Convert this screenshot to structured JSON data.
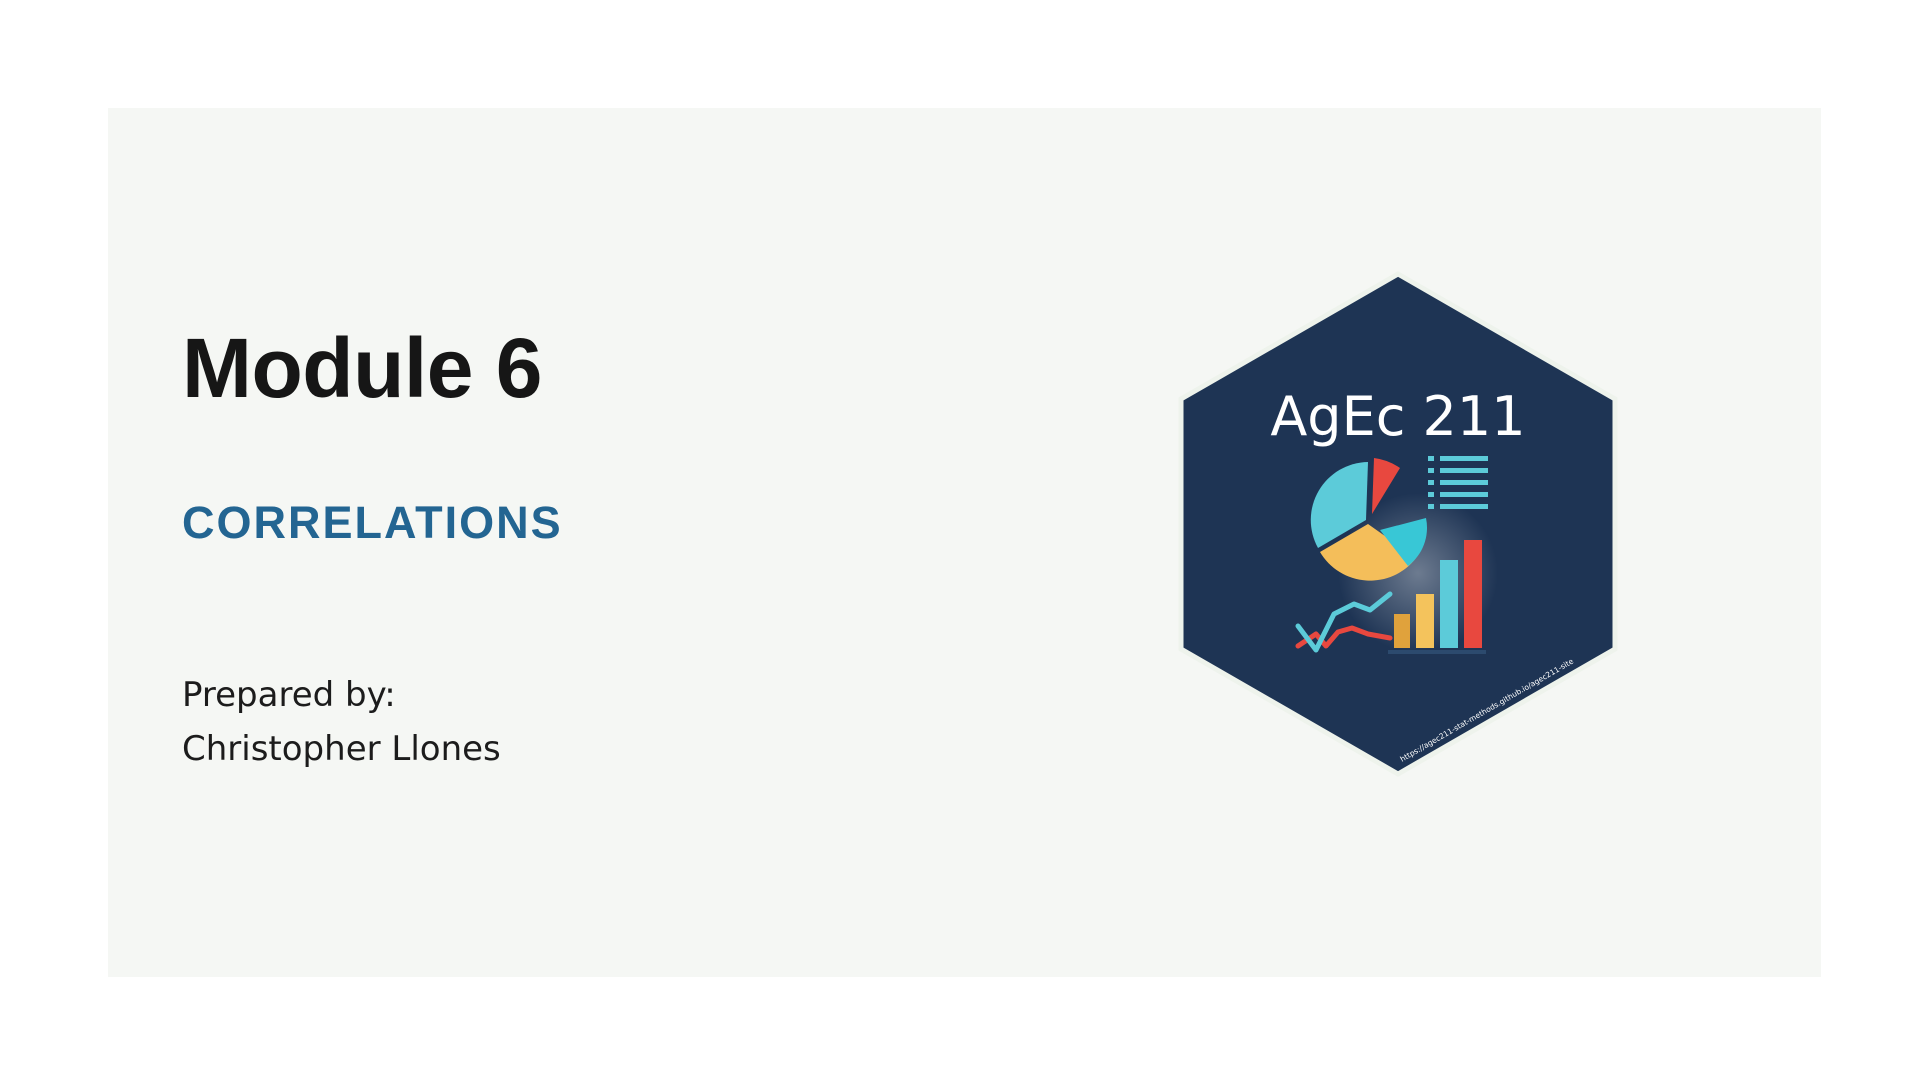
{
  "slide": {
    "title": "Module 6",
    "subtitle": "CORRELATIONS",
    "prepared_label": "Prepared by:",
    "author": "Christopher Llones"
  },
  "hex_sticker": {
    "course": "AgEc 211",
    "url": "https://agec211-stat-methods.github.io/agec211-site",
    "colors": {
      "background": "#1e3454",
      "pie_teal": "#5ccbd9",
      "pie_yellow": "#f4be5a",
      "pie_red": "#e8483f",
      "bar_orange": "#e0a23c",
      "bar_yellow": "#f4c35c",
      "bar_teal": "#5ccbd9",
      "bar_red": "#e8483f"
    },
    "icons": [
      "pie-chart-icon",
      "list-icon",
      "line-chart-icon",
      "bar-chart-icon"
    ]
  }
}
